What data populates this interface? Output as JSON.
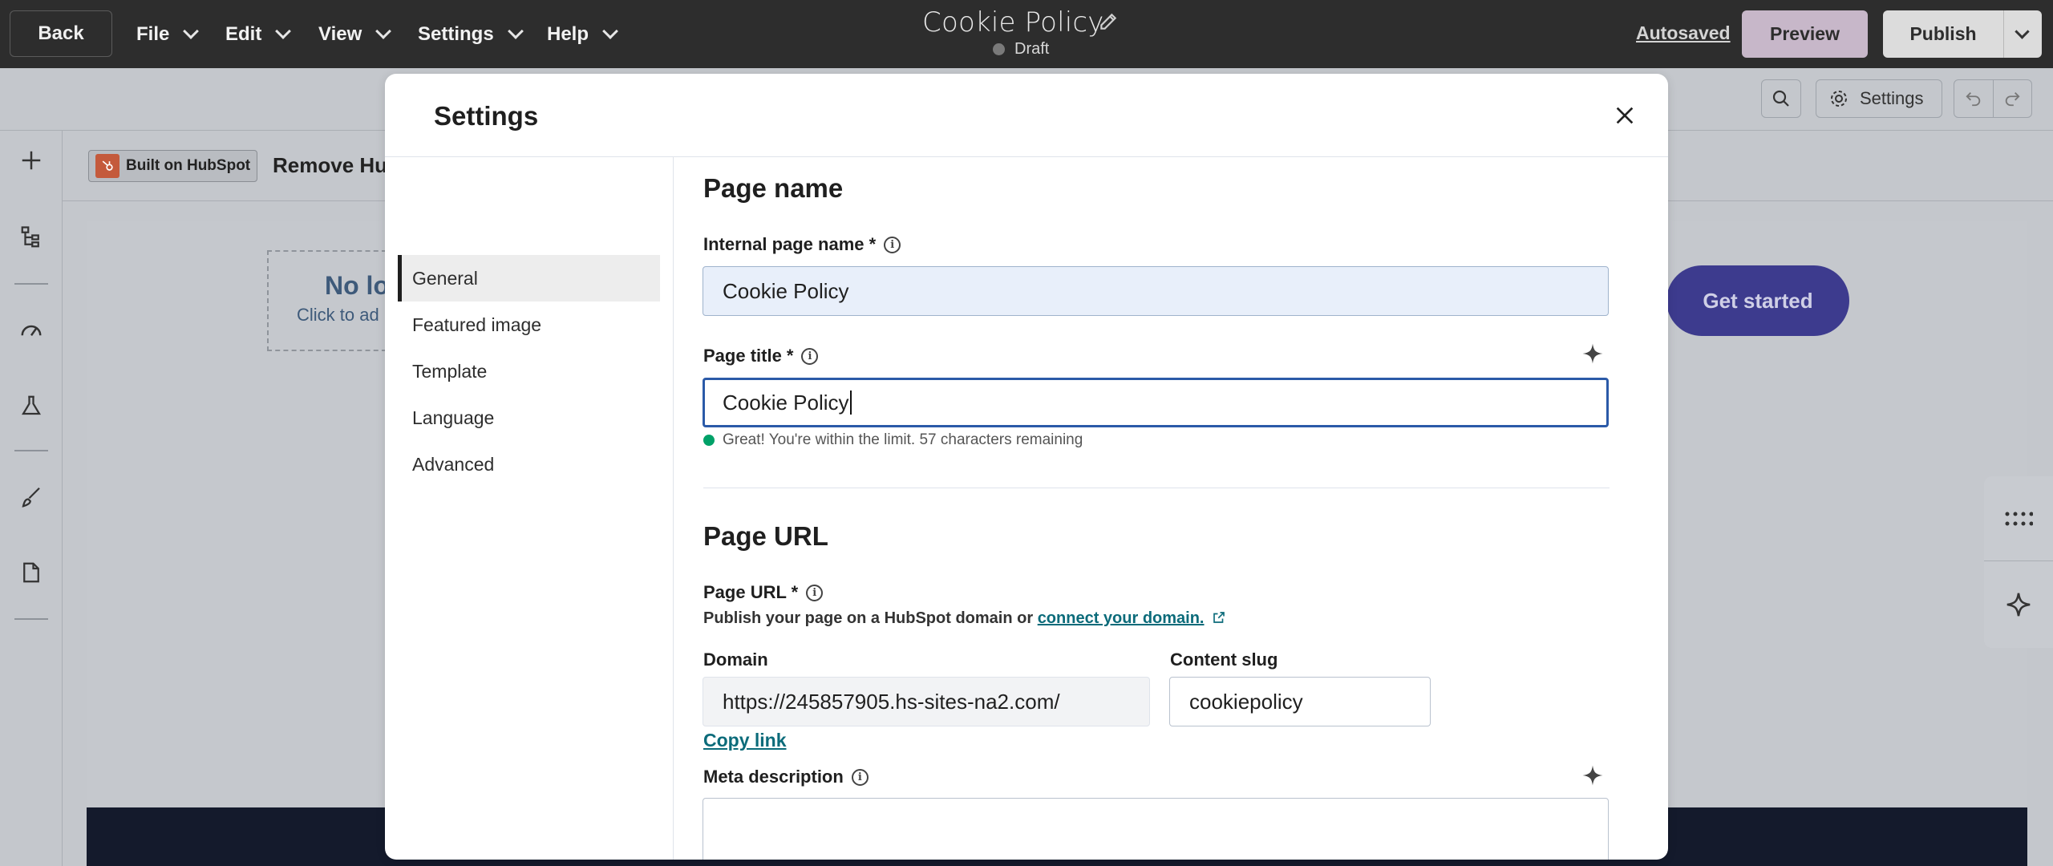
{
  "topbar": {
    "back_label": "Back",
    "menus": [
      {
        "label": "File"
      },
      {
        "label": "Edit"
      },
      {
        "label": "View"
      },
      {
        "label": "Settings"
      },
      {
        "label": "Help"
      }
    ],
    "doc_title": "Cookie Policy",
    "status": "Draft",
    "autosaved": "Autosaved",
    "preview_label": "Preview",
    "publish_label": "Publish"
  },
  "toolbar": {
    "settings_label": "Settings"
  },
  "canvas": {
    "built_badge": "Built on HubSpot",
    "remove_text": "Remove Hu",
    "logo_title": "No lo",
    "logo_sub": "Click to ad",
    "cta_label": "Get started"
  },
  "modal": {
    "title": "Settings",
    "nav": [
      {
        "label": "General",
        "active": true
      },
      {
        "label": "Featured image"
      },
      {
        "label": "Template"
      },
      {
        "label": "Language"
      },
      {
        "label": "Advanced"
      }
    ],
    "page_name_heading": "Page name",
    "internal_name_label": "Internal page name *",
    "internal_name_value": "Cookie Policy",
    "page_title_label": "Page title *",
    "page_title_value": "Cookie Policy",
    "title_hint": "Great! You're within the limit. 57 characters remaining",
    "page_url_heading": "Page URL",
    "page_url_label": "Page URL *",
    "page_url_desc": "Publish your page on a HubSpot domain or",
    "connect_domain": "connect your domain.",
    "domain_label": "Domain",
    "domain_value": "https://245857905.hs-sites-na2.com/",
    "slug_label": "Content slug",
    "slug_value": "cookiepolicy",
    "copy_link": "Copy link",
    "meta_label": "Meta description"
  },
  "colors": {
    "topbar_bg": "#2d2d2d",
    "preview_bg": "#c7b7c9",
    "cta_bg": "#3d3b8e",
    "link": "#0b6b7a",
    "focus": "#2b5aa8",
    "success": "#00a168"
  },
  "icons": [
    "pencil-icon",
    "chevron-down-icon",
    "search-icon",
    "gear-icon",
    "undo-icon",
    "redo-icon",
    "plus-icon",
    "tree-icon",
    "gauge-icon",
    "flask-icon",
    "brush-icon",
    "file-icon",
    "close-icon",
    "info-icon",
    "sparkle-icon",
    "external-link-icon",
    "grid-dots-icon"
  ]
}
